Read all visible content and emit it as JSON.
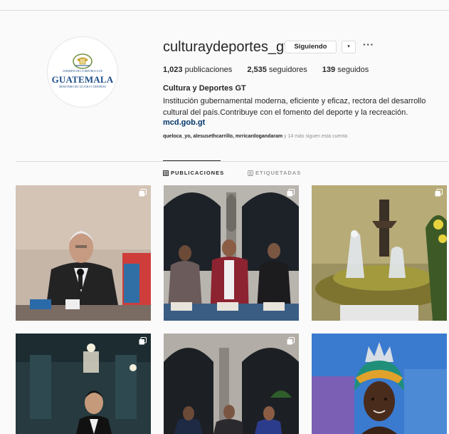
{
  "profile": {
    "username": "culturaydeportes_gt",
    "following_button_label": "Siguiendo",
    "dropdown_glyph": "▾",
    "more_glyph": "···",
    "stats": [
      {
        "value": "1,023",
        "label": "publicaciones"
      },
      {
        "value": "2,535",
        "label": "seguidores"
      },
      {
        "value": "139",
        "label": "seguidos"
      }
    ],
    "full_name": "Cultura y Deportes GT",
    "bio": "Institución gubernamental moderna, eficiente y eficaz, rectora del desarrollo cultural del país.Contribuye con el fomento del deporte y la recreación.",
    "website": "mcd.gob.gt",
    "followed_by_users": "queloca_yo, alesusethcarrillo, mrricardogandaram",
    "followed_by_rest": " y 14 más siguen esta cuenta",
    "avatar": {
      "small_top": "GOBIERNO DE LA REPÚBLICA DE",
      "word": "GUATEMALA",
      "small_bottom": "MINISTERIO DE CULTURA Y DEPORTES"
    }
  },
  "tabs": [
    {
      "label": "PUBLICACIONES",
      "icon": "grid-icon",
      "active": true
    },
    {
      "label": "ETIQUETADAS",
      "icon": "tagged-user-icon",
      "active": false
    }
  ],
  "posts": [
    {
      "subject": "speaker-at-microphone",
      "multiple": true
    },
    {
      "subject": "officials-at-ceremony",
      "multiple": true
    },
    {
      "subject": "nativity-scene",
      "multiple": true
    },
    {
      "subject": "man-in-hallway",
      "multiple": true
    },
    {
      "subject": "group-at-ceremony",
      "multiple": true
    },
    {
      "subject": "woman-with-crown",
      "multiple": false
    }
  ],
  "colors": {
    "text": "#262626",
    "muted": "#8e8e8e",
    "link": "#003569",
    "border": "#dbdbdb",
    "background": "#fafafa"
  }
}
